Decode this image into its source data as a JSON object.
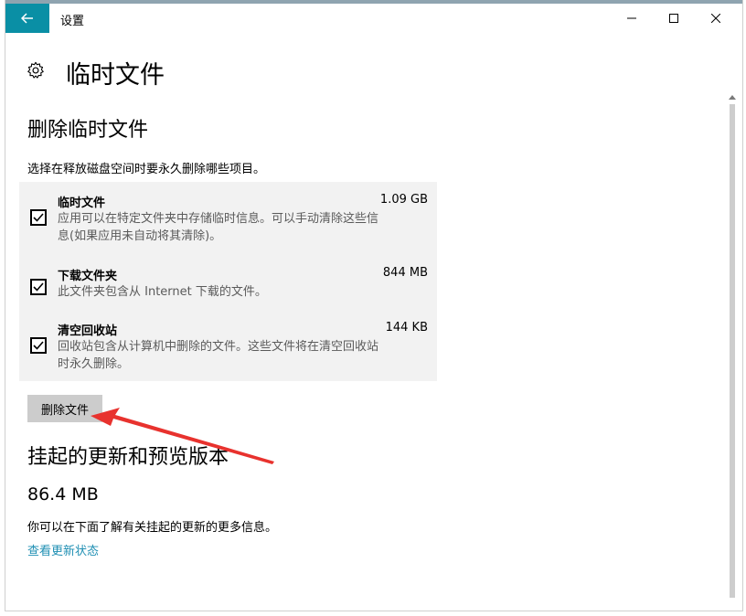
{
  "window": {
    "title": "设置"
  },
  "page": {
    "title": "临时文件"
  },
  "section1": {
    "title": "删除临时文件",
    "description": "选择在释放磁盘空间时要永久删除哪些项目。",
    "items": [
      {
        "name": "临时文件",
        "size": "1.09 GB",
        "desc_line1": "应用可以在特定文件夹中存储临时信息。可以手动清除这些信",
        "desc_line2": "息(如果应用未自动将其清除)。",
        "checked": true
      },
      {
        "name": "下载文件夹",
        "size": "844 MB",
        "desc_line1": "此文件夹包含从 Internet 下载的文件。",
        "desc_line2": "",
        "checked": true
      },
      {
        "name": "清空回收站",
        "size": "144 KB",
        "desc_line1": "回收站包含从计算机中删除的文件。这些文件将在清空回收站",
        "desc_line2": "时永久删除。",
        "checked": true
      }
    ],
    "delete_button": "删除文件"
  },
  "section2": {
    "title": "挂起的更新和预览版本",
    "size": "86.4 MB",
    "info": "你可以在下面了解有关挂起的更新的更多信息。",
    "link": "查看更新状态"
  },
  "colors": {
    "accent": "#0a8fa5",
    "link": "#1f8fb3",
    "arrow": "#e8322e"
  },
  "icons": [
    "back-arrow-icon",
    "minimize-icon",
    "maximize-icon",
    "close-icon",
    "gear-icon",
    "checkmark-icon",
    "scroll-up-icon"
  ]
}
